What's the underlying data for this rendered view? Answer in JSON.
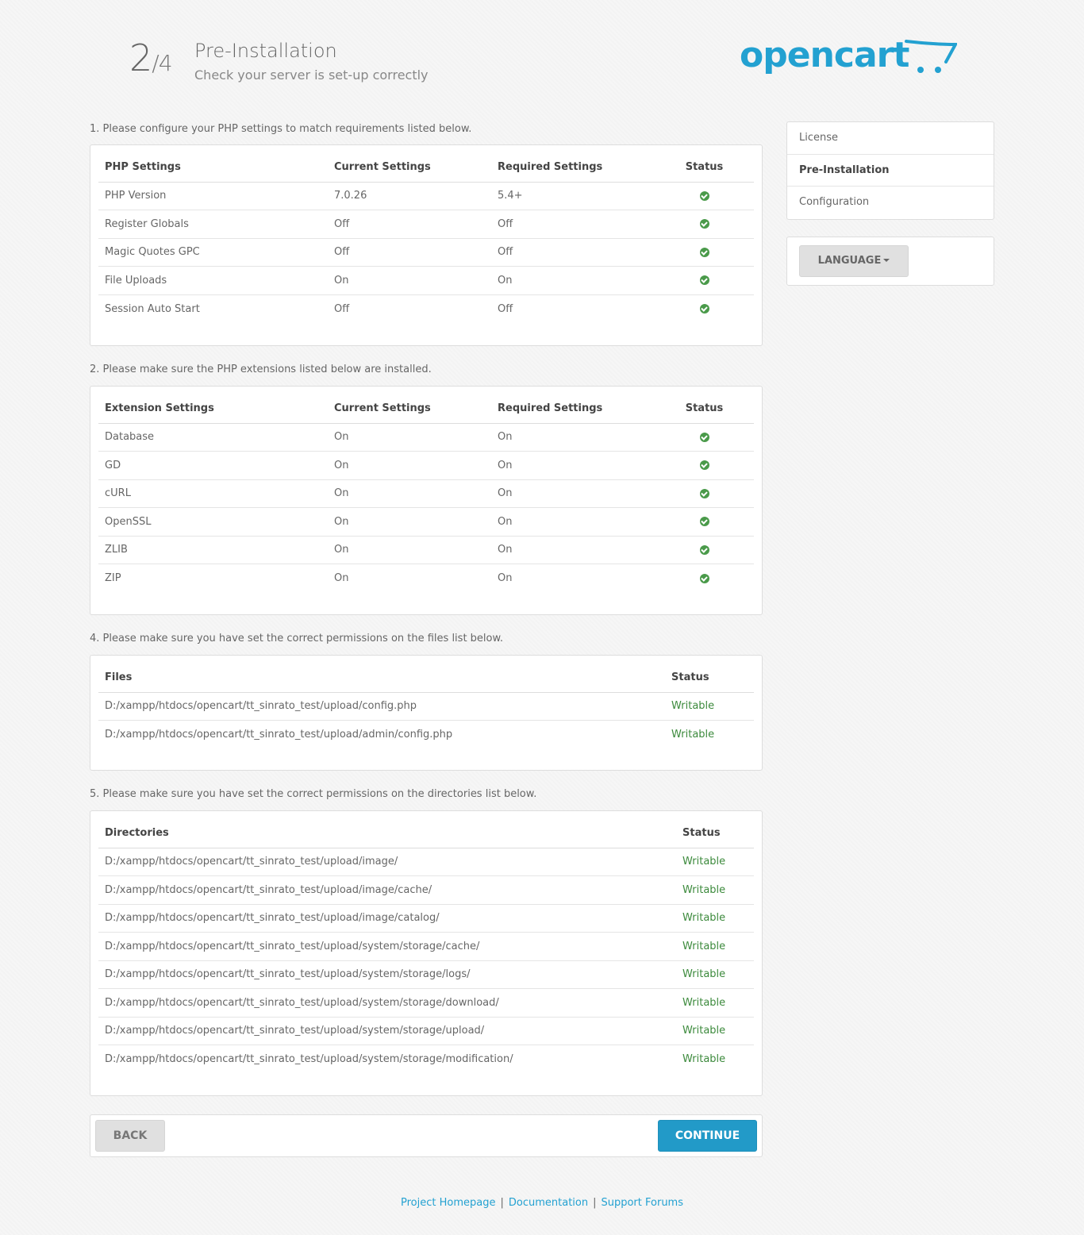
{
  "header": {
    "step": "2",
    "step_total": "/4",
    "title": "Pre-Installation",
    "subtitle": "Check your server is set-up correctly",
    "logo_text": "opencart"
  },
  "sections": {
    "php": {
      "label": "1. Please configure your PHP settings to match requirements listed below.",
      "columns": [
        "PHP Settings",
        "Current Settings",
        "Required Settings",
        "Status"
      ],
      "rows": [
        {
          "name": "PHP Version",
          "current": "7.0.26",
          "required": "5.4+"
        },
        {
          "name": "Register Globals",
          "current": "Off",
          "required": "Off"
        },
        {
          "name": "Magic Quotes GPC",
          "current": "Off",
          "required": "Off"
        },
        {
          "name": "File Uploads",
          "current": "On",
          "required": "On"
        },
        {
          "name": "Session Auto Start",
          "current": "Off",
          "required": "Off"
        }
      ]
    },
    "extensions": {
      "label": "2. Please make sure the PHP extensions listed below are installed.",
      "columns": [
        "Extension Settings",
        "Current Settings",
        "Required Settings",
        "Status"
      ],
      "rows": [
        {
          "name": "Database",
          "current": "On",
          "required": "On"
        },
        {
          "name": "GD",
          "current": "On",
          "required": "On"
        },
        {
          "name": "cURL",
          "current": "On",
          "required": "On"
        },
        {
          "name": "OpenSSL",
          "current": "On",
          "required": "On"
        },
        {
          "name": "ZLIB",
          "current": "On",
          "required": "On"
        },
        {
          "name": "ZIP",
          "current": "On",
          "required": "On"
        }
      ]
    },
    "files": {
      "label": "4. Please make sure you have set the correct permissions on the files list below.",
      "columns": [
        "Files",
        "Status"
      ],
      "rows": [
        {
          "path": "D:/xampp/htdocs/opencart/tt_sinrato_test/upload/config.php",
          "status": "Writable"
        },
        {
          "path": "D:/xampp/htdocs/opencart/tt_sinrato_test/upload/admin/config.php",
          "status": "Writable"
        }
      ]
    },
    "directories": {
      "label": "5. Please make sure you have set the correct permissions on the directories list below.",
      "columns": [
        "Directories",
        "Status"
      ],
      "rows": [
        {
          "path": "D:/xampp/htdocs/opencart/tt_sinrato_test/upload/image/",
          "status": "Writable"
        },
        {
          "path": "D:/xampp/htdocs/opencart/tt_sinrato_test/upload/image/cache/",
          "status": "Writable"
        },
        {
          "path": "D:/xampp/htdocs/opencart/tt_sinrato_test/upload/image/catalog/",
          "status": "Writable"
        },
        {
          "path": "D:/xampp/htdocs/opencart/tt_sinrato_test/upload/system/storage/cache/",
          "status": "Writable"
        },
        {
          "path": "D:/xampp/htdocs/opencart/tt_sinrato_test/upload/system/storage/logs/",
          "status": "Writable"
        },
        {
          "path": "D:/xampp/htdocs/opencart/tt_sinrato_test/upload/system/storage/download/",
          "status": "Writable"
        },
        {
          "path": "D:/xampp/htdocs/opencart/tt_sinrato_test/upload/system/storage/upload/",
          "status": "Writable"
        },
        {
          "path": "D:/xampp/htdocs/opencart/tt_sinrato_test/upload/system/storage/modification/",
          "status": "Writable"
        }
      ]
    }
  },
  "sidebar": {
    "items": [
      {
        "label": "License",
        "active": false
      },
      {
        "label": "Pre-Installation",
        "active": true
      },
      {
        "label": "Configuration",
        "active": false
      }
    ],
    "language_label": "LANGUAGE"
  },
  "buttons": {
    "back": "BACK",
    "continue": "CONTINUE"
  },
  "footer": {
    "links": [
      "Project Homepage",
      "Documentation",
      "Support Forums"
    ],
    "separator": "|"
  },
  "colors": {
    "brand": "#23a1d1",
    "ok": "#4a9a4a",
    "writable": "#3c8a3c"
  },
  "icons": {
    "status_ok": "check-circle-icon",
    "cart": "cart-icon",
    "caret": "caret-down-icon"
  }
}
